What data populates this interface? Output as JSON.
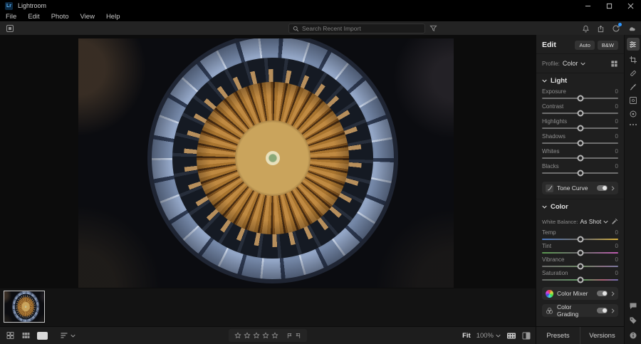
{
  "titlebar": {
    "app_title": "Lightroom"
  },
  "menubar": {
    "items": [
      "File",
      "Edit",
      "Photo",
      "View",
      "Help"
    ]
  },
  "toolbar": {
    "search_placeholder": "Search Recent Import"
  },
  "edit_panel": {
    "title": "Edit",
    "auto_button": "Auto",
    "bw_button": "B&W",
    "profile_label": "Profile:",
    "profile_value": "Color",
    "light_section": {
      "header": "Light",
      "sliders": [
        {
          "label": "Exposure",
          "value": "0"
        },
        {
          "label": "Contrast",
          "value": "0"
        },
        {
          "label": "Highlights",
          "value": "0"
        },
        {
          "label": "Shadows",
          "value": "0"
        },
        {
          "label": "Whites",
          "value": "0"
        },
        {
          "label": "Blacks",
          "value": "0"
        }
      ]
    },
    "tone_curve_label": "Tone Curve",
    "color_section": {
      "header": "Color",
      "wb_label": "White Balance:",
      "wb_value": "As Shot",
      "sliders": [
        {
          "label": "Temp",
          "value": "0"
        },
        {
          "label": "Tint",
          "value": "0"
        },
        {
          "label": "Vibrance",
          "value": "0"
        },
        {
          "label": "Saturation",
          "value": "0"
        }
      ]
    },
    "color_mixer_label": "Color Mixer",
    "color_grading_label": "Color Grading"
  },
  "bottom_bar": {
    "zoom_fit": "Fit",
    "zoom_level": "100%"
  },
  "panel_footer": {
    "presets": "Presets",
    "versions": "Versions"
  },
  "colors": {
    "accent_blue": "#2d96ff",
    "panel_bg": "#1f1f1f",
    "canvas_bg": "#0c0c0c"
  }
}
